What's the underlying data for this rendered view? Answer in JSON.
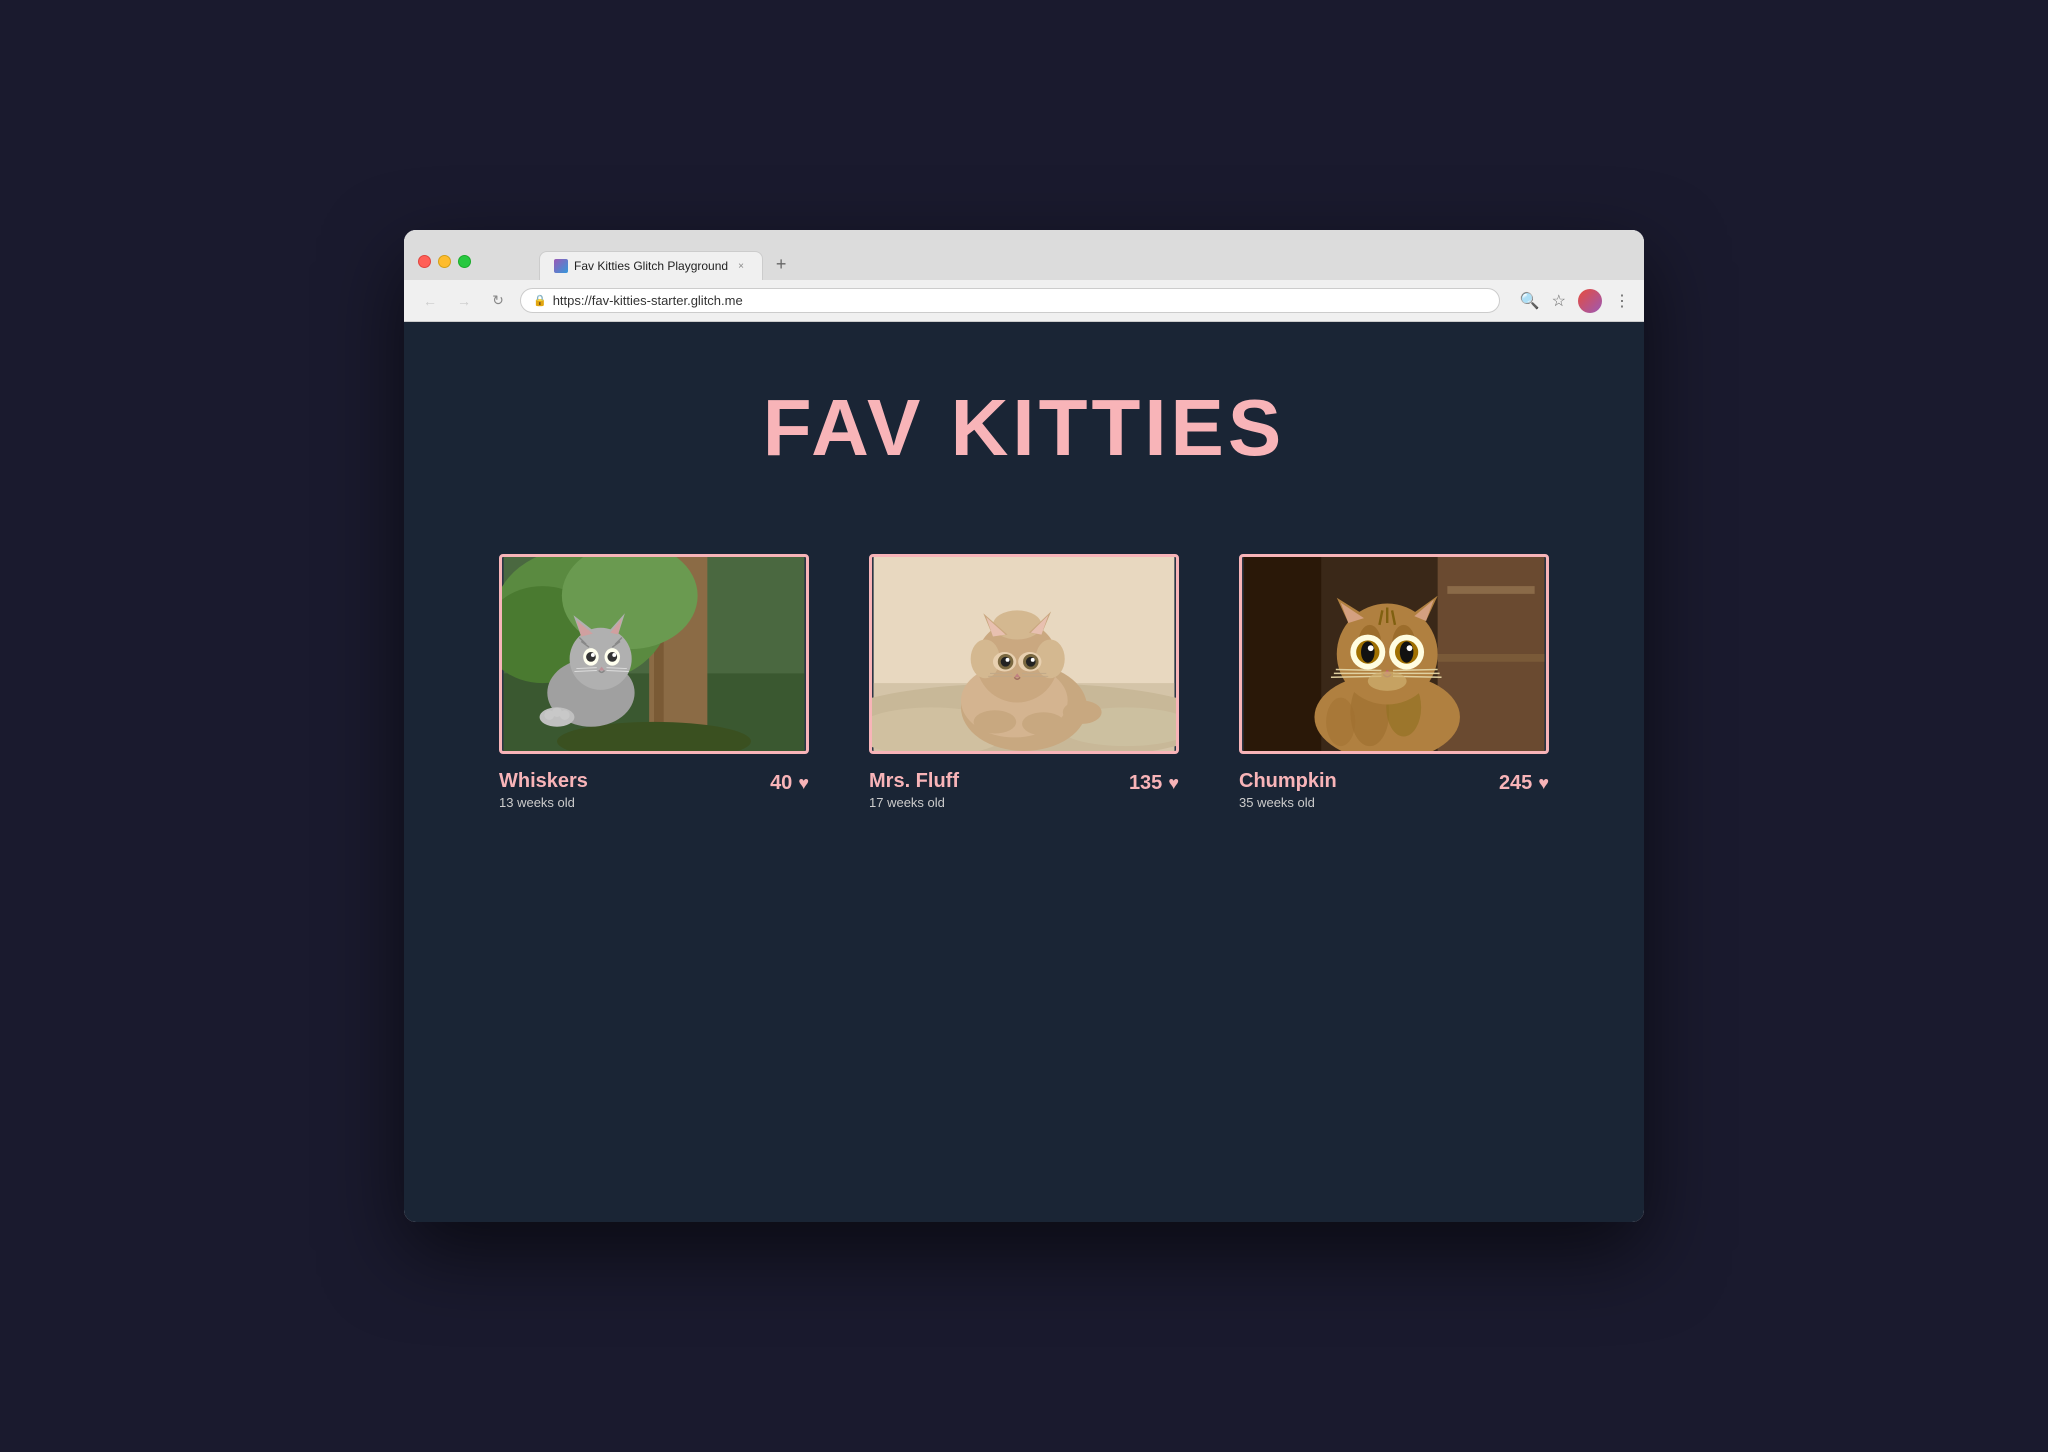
{
  "browser": {
    "tab_title": "Fav Kitties Glitch Playground",
    "tab_close": "×",
    "new_tab": "+",
    "url": "https://fav-kitties-starter.glitch.me",
    "back_label": "←",
    "forward_label": "→",
    "reload_label": "↻"
  },
  "page": {
    "title": "FAV KITTIES",
    "background_color": "#1a2535",
    "accent_color": "#f8b4b8"
  },
  "kitties": [
    {
      "id": "whiskers",
      "name": "Whiskers",
      "age": "13 weeks old",
      "hearts": "40",
      "image_desc": "gray kitten in nature near tree",
      "colors": [
        "#7a9b6a",
        "#8b7355",
        "#6b8e5a",
        "#5a7a4a",
        "#a09070"
      ]
    },
    {
      "id": "mrs-fluff",
      "name": "Mrs. Fluff",
      "age": "17 weeks old",
      "hearts": "135",
      "image_desc": "fluffy kitten sepia tones",
      "colors": [
        "#c4a882",
        "#d4b892",
        "#b89870",
        "#a08060",
        "#e8d4b8"
      ]
    },
    {
      "id": "chumpkin",
      "name": "Chumpkin",
      "age": "35 weeks old",
      "hearts": "245",
      "image_desc": "tabby adult cat looking up",
      "colors": [
        "#6b5040",
        "#7a6050",
        "#8b7060",
        "#4a3830",
        "#9a8070"
      ]
    }
  ]
}
